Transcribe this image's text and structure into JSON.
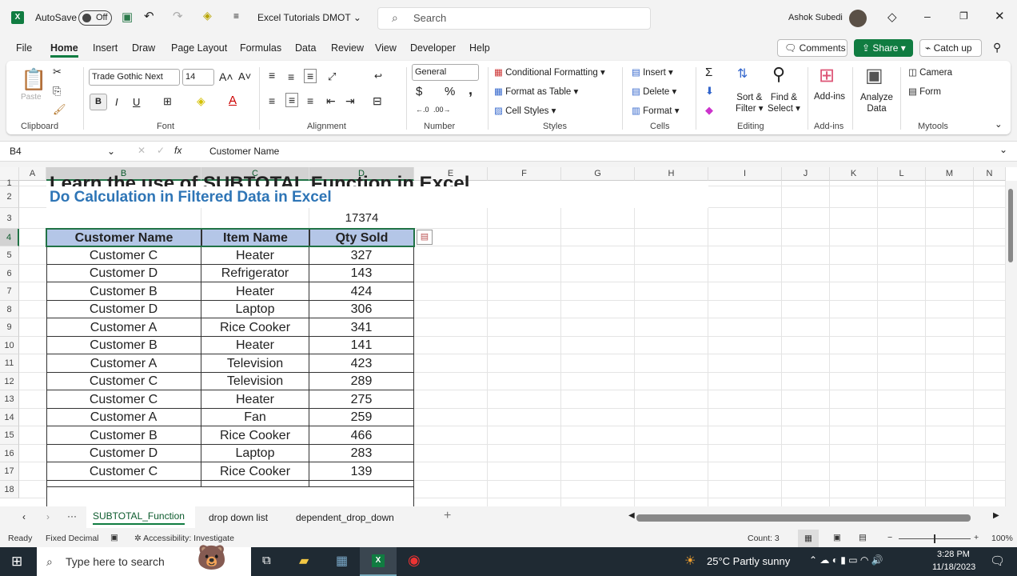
{
  "titlebar": {
    "autosave": "AutoSave",
    "autosave_state": "Off",
    "doc_title": "Excel Tutorials DMOT",
    "search_placeholder": "Search",
    "user": "Ashok Subedi"
  },
  "menu": [
    "File",
    "Home",
    "Insert",
    "Draw",
    "Page Layout",
    "Formulas",
    "Data",
    "Review",
    "View",
    "Developer",
    "Help"
  ],
  "actions": {
    "comments": "Comments",
    "share": "Share",
    "catchup": "Catch up"
  },
  "ribbon": {
    "clipboard": {
      "paste": "Paste",
      "label": "Clipboard"
    },
    "font": {
      "name": "Trade Gothic Next",
      "size": "14",
      "bold": "B",
      "italic": "I",
      "underline": "U",
      "label": "Font"
    },
    "alignment": {
      "label": "Alignment"
    },
    "number": {
      "format": "General",
      "currency": "$",
      "percent": "%",
      "comma": ",",
      "label": "Number"
    },
    "styles": {
      "cond": "Conditional Formatting",
      "table": "Format as Table",
      "cell": "Cell Styles",
      "label": "Styles"
    },
    "cells": {
      "insert": "Insert",
      "delete": "Delete",
      "format": "Format",
      "label": "Cells"
    },
    "editing": {
      "sum": "Σ",
      "sort": "Sort &",
      "sort2": "Filter",
      "find": "Find &",
      "find2": "Select",
      "label": "Editing"
    },
    "addins": {
      "btn": "Add-ins",
      "label": "Add-ins"
    },
    "analyze": {
      "l1": "Analyze",
      "l2": "Data"
    },
    "mytools": {
      "camera": "Camera",
      "form": "Form",
      "label": "Mytools"
    }
  },
  "formula_bar": {
    "name_box": "B4",
    "fx": "fx",
    "content": "Customer Name"
  },
  "columns": [
    "A",
    "B",
    "C",
    "D",
    "E",
    "F",
    "G",
    "H",
    "I",
    "J",
    "K",
    "L",
    "M",
    "N"
  ],
  "sheet": {
    "title": "Learn the use of SUBTOTAL Function in Excel",
    "subtitle": "Do Calculation in Filtered Data in Excel",
    "subtotal": "17374",
    "headers": [
      "Customer Name",
      "Item Name",
      "Qty Sold"
    ],
    "rows": [
      [
        "Customer C",
        "Heater",
        "327"
      ],
      [
        "Customer D",
        "Refrigerator",
        "143"
      ],
      [
        "Customer B",
        "Heater",
        "424"
      ],
      [
        "Customer D",
        "Laptop",
        "306"
      ],
      [
        "Customer A",
        "Rice Cooker",
        "341"
      ],
      [
        "Customer B",
        "Heater",
        "141"
      ],
      [
        "Customer A",
        "Television",
        "423"
      ],
      [
        "Customer C",
        "Television",
        "289"
      ],
      [
        "Customer C",
        "Heater",
        "275"
      ],
      [
        "Customer A",
        "Fan",
        "259"
      ],
      [
        "Customer B",
        "Rice Cooker",
        "466"
      ],
      [
        "Customer D",
        "Laptop",
        "283"
      ],
      [
        "Customer C",
        "Rice Cooker",
        "139"
      ]
    ]
  },
  "tabs": [
    "SUBTOTAL_Function",
    "drop down list",
    "dependent_drop_down"
  ],
  "status": {
    "ready": "Ready",
    "fixed": "Fixed Decimal",
    "access": "Accessibility: Investigate",
    "count": "Count: 3",
    "zoom": "100%"
  },
  "taskbar": {
    "search": "Type here to search",
    "weather": "25°C  Partly sunny",
    "time": "3:28 PM",
    "date": "11/18/2023"
  },
  "colors": {
    "excel_green": "#107c41",
    "header_fill": "#b4c6e7",
    "subtitle": "#2e75b6"
  }
}
